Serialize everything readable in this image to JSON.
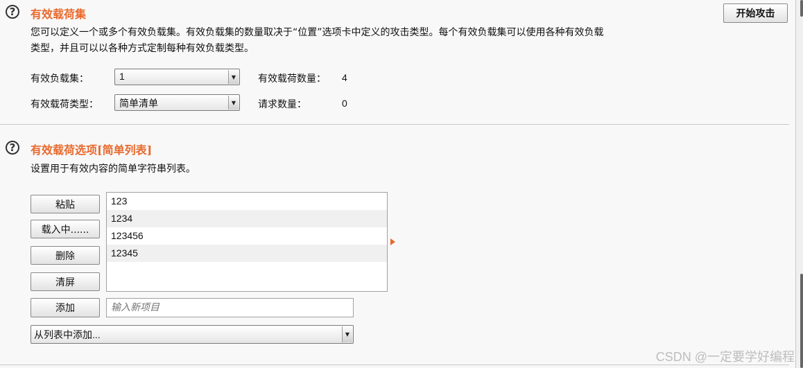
{
  "payload_sets": {
    "title": "有效载荷集",
    "start_attack": "开始攻击",
    "description_line1": "您可以定义一个或多个有效负载集。有效负载集的数量取决于“位置”选项卡中定义的攻击类型。每个有效负载集可以使用各种有效负载",
    "description_line2": "类型，并且可以以各种方式定制每种有效负载类型。",
    "set_label": "有效负载集：",
    "set_value": "1",
    "count_label": "有效载荷数量：",
    "count_value": "4",
    "type_label": "有效载荷类型：",
    "type_value": "简单清单",
    "requests_label": "请求数量：",
    "requests_value": "0"
  },
  "payload_options": {
    "title": "有效载荷选项[简单列表]",
    "description": "设置用于有效内容的简单字符串列表。",
    "buttons": {
      "paste": "粘贴",
      "load": "载入中......",
      "remove": "删除",
      "clear": "清屏",
      "add": "添加"
    },
    "items": [
      "123",
      "1234",
      "123456",
      "12345"
    ],
    "new_item_placeholder": "输入新项目",
    "add_from_list": "从列表中添加..."
  },
  "watermark": "CSDN @一定要学好编程",
  "colors": {
    "section_title": "#e8692c",
    "insert_arrow": "#e8692c"
  }
}
